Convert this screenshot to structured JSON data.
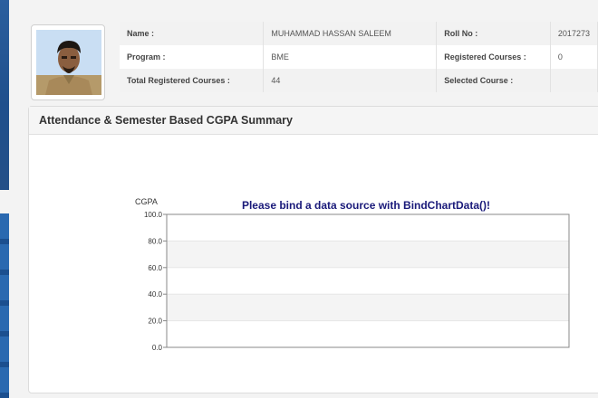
{
  "student": {
    "name_label": "Name :",
    "name_value": "MUHAMMAD HASSAN SALEEM",
    "roll_label": "Roll No :",
    "roll_value": "2017273",
    "program_label": "Program :",
    "program_value": "BME",
    "registered_label": "Registered Courses :",
    "registered_value": "0",
    "total_label": "Total Registered Courses :",
    "total_value": "44",
    "selected_label": "Selected Course :",
    "selected_value": ""
  },
  "panel": {
    "title": "Attendance & Semester Based CGPA Summary"
  },
  "chart_data": {
    "type": "bar",
    "title": "Please bind a data source with BindChartData()!",
    "ylabel": "CGPA",
    "xlabel": "",
    "ylim": [
      0,
      100
    ],
    "yticks": [
      "100.0",
      "80.0",
      "60.0",
      "40.0",
      "20.0",
      "0.0"
    ],
    "categories": [],
    "values": [],
    "grid": true,
    "colors": {
      "title": "#1a1a7a",
      "band": "#f4f4f4",
      "axis": "#888888"
    }
  }
}
